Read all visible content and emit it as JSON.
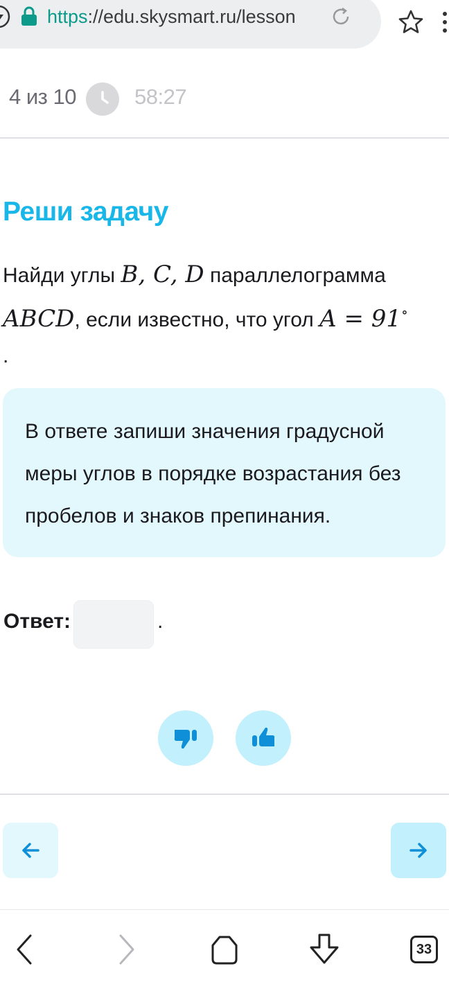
{
  "browser": {
    "url_scheme": "https",
    "url_rest": "://edu.skysmart.ru/lesson",
    "tabs_count": "33"
  },
  "progress": {
    "label": "4 из 10",
    "timer": "58:27"
  },
  "task": {
    "title": "Реши задачу",
    "q_text_1": "Найди углы ",
    "q_math_1": "B, C, D",
    "q_text_2": " параллелограмма",
    "q_math_2": "ABCD",
    "q_text_3": ", если известно, что угол ",
    "q_math_3": "A = 91",
    "q_degree": "∘",
    "q_end": "."
  },
  "hint": {
    "text": "В ответе запиши значения градусной меры углов в порядке возрастания без пробелов и знаков препинания."
  },
  "answer": {
    "label": "Ответ:",
    "value": "",
    "trailing": "."
  },
  "colors": {
    "accent": "#19b6e8",
    "hint_bg": "#e3f8fd",
    "button_bg": "#c2f0fc",
    "icon_blue": "#0e8fd8"
  }
}
